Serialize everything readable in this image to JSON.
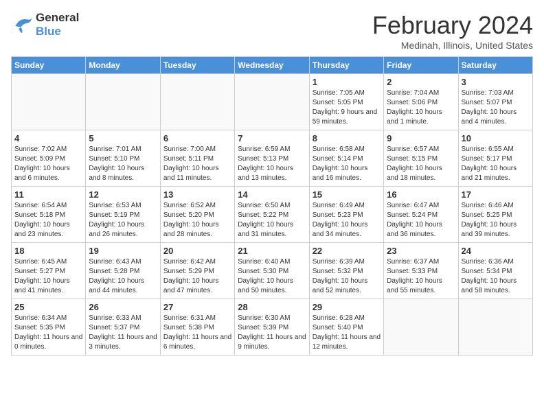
{
  "header": {
    "logo_line1": "General",
    "logo_line2": "Blue",
    "month": "February 2024",
    "location": "Medinah, Illinois, United States"
  },
  "days_of_week": [
    "Sunday",
    "Monday",
    "Tuesday",
    "Wednesday",
    "Thursday",
    "Friday",
    "Saturday"
  ],
  "weeks": [
    [
      {
        "day": "",
        "empty": true
      },
      {
        "day": "",
        "empty": true
      },
      {
        "day": "",
        "empty": true
      },
      {
        "day": "",
        "empty": true
      },
      {
        "day": "1",
        "sunrise": "7:05 AM",
        "sunset": "5:05 PM",
        "daylight": "9 hours and 59 minutes."
      },
      {
        "day": "2",
        "sunrise": "7:04 AM",
        "sunset": "5:06 PM",
        "daylight": "10 hours and 1 minute."
      },
      {
        "day": "3",
        "sunrise": "7:03 AM",
        "sunset": "5:07 PM",
        "daylight": "10 hours and 4 minutes."
      }
    ],
    [
      {
        "day": "4",
        "sunrise": "7:02 AM",
        "sunset": "5:09 PM",
        "daylight": "10 hours and 6 minutes."
      },
      {
        "day": "5",
        "sunrise": "7:01 AM",
        "sunset": "5:10 PM",
        "daylight": "10 hours and 8 minutes."
      },
      {
        "day": "6",
        "sunrise": "7:00 AM",
        "sunset": "5:11 PM",
        "daylight": "10 hours and 11 minutes."
      },
      {
        "day": "7",
        "sunrise": "6:59 AM",
        "sunset": "5:13 PM",
        "daylight": "10 hours and 13 minutes."
      },
      {
        "day": "8",
        "sunrise": "6:58 AM",
        "sunset": "5:14 PM",
        "daylight": "10 hours and 16 minutes."
      },
      {
        "day": "9",
        "sunrise": "6:57 AM",
        "sunset": "5:15 PM",
        "daylight": "10 hours and 18 minutes."
      },
      {
        "day": "10",
        "sunrise": "6:55 AM",
        "sunset": "5:17 PM",
        "daylight": "10 hours and 21 minutes."
      }
    ],
    [
      {
        "day": "11",
        "sunrise": "6:54 AM",
        "sunset": "5:18 PM",
        "daylight": "10 hours and 23 minutes."
      },
      {
        "day": "12",
        "sunrise": "6:53 AM",
        "sunset": "5:19 PM",
        "daylight": "10 hours and 26 minutes."
      },
      {
        "day": "13",
        "sunrise": "6:52 AM",
        "sunset": "5:20 PM",
        "daylight": "10 hours and 28 minutes."
      },
      {
        "day": "14",
        "sunrise": "6:50 AM",
        "sunset": "5:22 PM",
        "daylight": "10 hours and 31 minutes."
      },
      {
        "day": "15",
        "sunrise": "6:49 AM",
        "sunset": "5:23 PM",
        "daylight": "10 hours and 34 minutes."
      },
      {
        "day": "16",
        "sunrise": "6:47 AM",
        "sunset": "5:24 PM",
        "daylight": "10 hours and 36 minutes."
      },
      {
        "day": "17",
        "sunrise": "6:46 AM",
        "sunset": "5:25 PM",
        "daylight": "10 hours and 39 minutes."
      }
    ],
    [
      {
        "day": "18",
        "sunrise": "6:45 AM",
        "sunset": "5:27 PM",
        "daylight": "10 hours and 41 minutes."
      },
      {
        "day": "19",
        "sunrise": "6:43 AM",
        "sunset": "5:28 PM",
        "daylight": "10 hours and 44 minutes."
      },
      {
        "day": "20",
        "sunrise": "6:42 AM",
        "sunset": "5:29 PM",
        "daylight": "10 hours and 47 minutes."
      },
      {
        "day": "21",
        "sunrise": "6:40 AM",
        "sunset": "5:30 PM",
        "daylight": "10 hours and 50 minutes."
      },
      {
        "day": "22",
        "sunrise": "6:39 AM",
        "sunset": "5:32 PM",
        "daylight": "10 hours and 52 minutes."
      },
      {
        "day": "23",
        "sunrise": "6:37 AM",
        "sunset": "5:33 PM",
        "daylight": "10 hours and 55 minutes."
      },
      {
        "day": "24",
        "sunrise": "6:36 AM",
        "sunset": "5:34 PM",
        "daylight": "10 hours and 58 minutes."
      }
    ],
    [
      {
        "day": "25",
        "sunrise": "6:34 AM",
        "sunset": "5:35 PM",
        "daylight": "11 hours and 0 minutes."
      },
      {
        "day": "26",
        "sunrise": "6:33 AM",
        "sunset": "5:37 PM",
        "daylight": "11 hours and 3 minutes."
      },
      {
        "day": "27",
        "sunrise": "6:31 AM",
        "sunset": "5:38 PM",
        "daylight": "11 hours and 6 minutes."
      },
      {
        "day": "28",
        "sunrise": "6:30 AM",
        "sunset": "5:39 PM",
        "daylight": "11 hours and 9 minutes."
      },
      {
        "day": "29",
        "sunrise": "6:28 AM",
        "sunset": "5:40 PM",
        "daylight": "11 hours and 12 minutes."
      },
      {
        "day": "",
        "empty": true
      },
      {
        "day": "",
        "empty": true
      }
    ]
  ],
  "labels": {
    "sunrise_label": "Sunrise:",
    "sunset_label": "Sunset:",
    "daylight_label": "Daylight:"
  }
}
